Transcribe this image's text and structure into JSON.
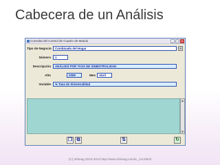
{
  "slide": {
    "title": "Cabecera de un Análisis",
    "footer": "(C) Infoeag 2010-2013 http://www.infoeag.com/ic_cst.shtml"
  },
  "window": {
    "title": "Consulta del Control de Cuadro de Mando",
    "controls": [
      "_",
      "□",
      "×"
    ]
  },
  "form": {
    "tipo_negocio": {
      "label": "Tipo de Negocio",
      "value": "Combinado del Hogar"
    },
    "numero": {
      "label": "Número",
      "value": "1"
    },
    "descripcion": {
      "label": "Descripción",
      "value": "ANÁLISIS POR TASA DE SINIESTRALIDAD"
    },
    "anio": {
      "label": "Año",
      "value": "2008"
    },
    "mes": {
      "label": "Mes",
      "value": "Abril"
    },
    "variable": {
      "label": "Variable",
      "value": "% Tasa de Siniestralidad"
    }
  },
  "toolbar": {
    "copy_icon": "❐",
    "paste_icon": "⧉",
    "sort_icon": "⇅",
    "exit_icon": "↻"
  },
  "colors": {
    "grid_bg": "#9fd6d2",
    "field_border": "#2b4fb3",
    "field_text": "#1a2f9a"
  }
}
